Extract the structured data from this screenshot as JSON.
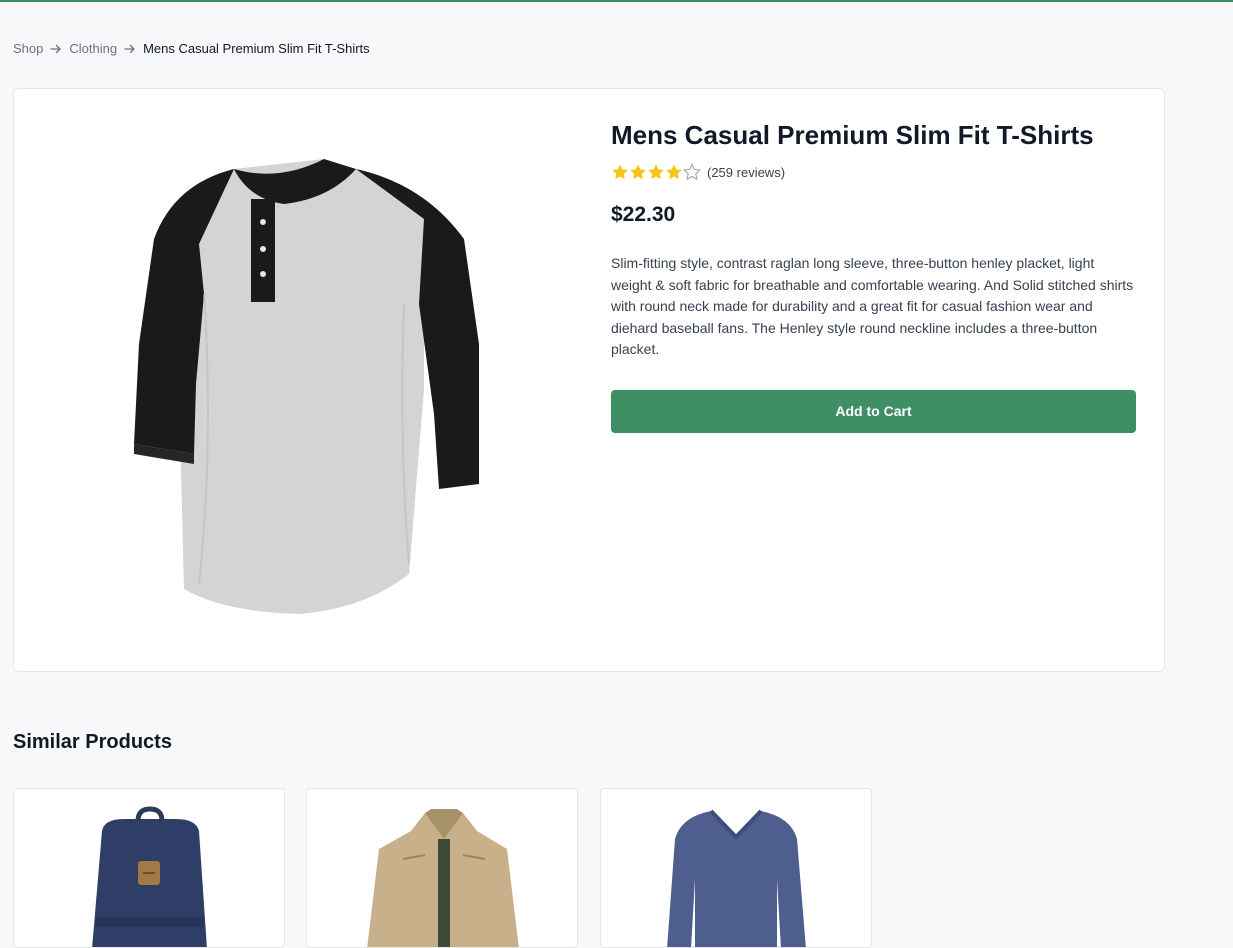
{
  "breadcrumb": {
    "items": [
      "Shop",
      "Clothing",
      "Mens Casual Premium Slim Fit T-Shirts"
    ]
  },
  "product": {
    "title": "Mens Casual Premium Slim Fit T-Shirts",
    "rating": 4,
    "rating_max": 5,
    "reviews_text": "(259 reviews)",
    "price": "$22.30",
    "description": "Slim-fitting style, contrast raglan long sleeve, three-button henley placket, light weight & soft fabric for breathable and comfortable wearing. And Solid stitched shirts with round neck made for durability and a great fit for casual fashion wear and diehard baseball fans. The Henley style round neckline includes a three-button placket.",
    "add_to_cart_label": "Add to Cart"
  },
  "similar": {
    "heading": "Similar Products",
    "items": [
      {
        "icon": "backpack-image"
      },
      {
        "icon": "jacket-image"
      },
      {
        "icon": "long-sleeve-shirt-image"
      }
    ]
  },
  "colors": {
    "accent": "#3f8f65",
    "star": "#f5c518"
  }
}
